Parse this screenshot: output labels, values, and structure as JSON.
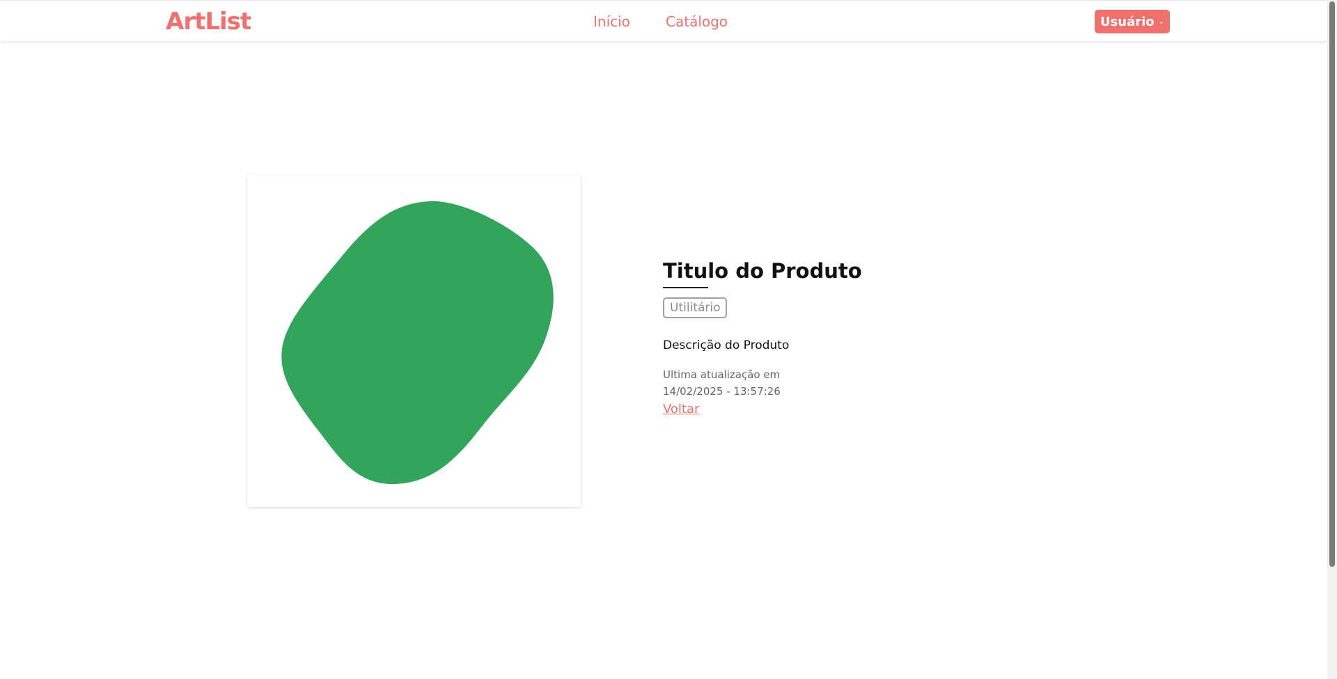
{
  "brand": {
    "logo_text": "ArtList",
    "accent_color": "#f0706e"
  },
  "nav": {
    "home_label": "Início",
    "catalog_label": "Catálogo",
    "user_label": "Usuário"
  },
  "product": {
    "title": "Titulo do Produto",
    "tag": "Utilitário",
    "description": "Descrição do Produto",
    "updated_label": "Ultima atualização em",
    "updated_value": "14/02/2025 - 13:57:26",
    "back_label": "Voltar",
    "image_color": "#32a55a"
  }
}
